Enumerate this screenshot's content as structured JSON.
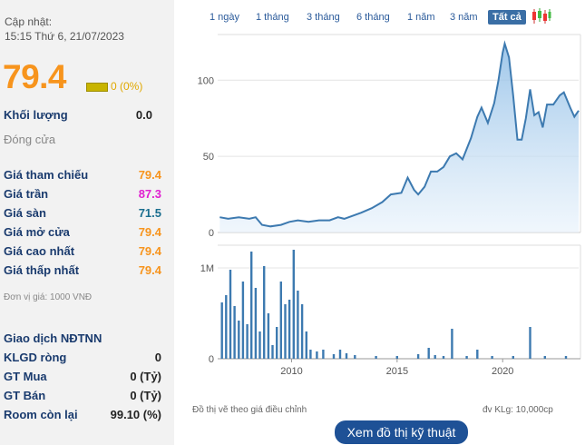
{
  "header": {
    "update_label": "Cập nhật:",
    "update_time": "15:15 Thứ 6, 21/07/2023",
    "price": "79.4",
    "change": "0 (0%)"
  },
  "volume": {
    "label": "Khối lượng",
    "value": "0.0"
  },
  "status": "Đóng cửa",
  "prices": [
    {
      "label": "Giá tham chiếu",
      "value": "79.4",
      "color": "#f7941d"
    },
    {
      "label": "Giá trần",
      "value": "87.3",
      "color": "#e020d0"
    },
    {
      "label": "Giá sàn",
      "value": "71.5",
      "color": "#1a6e8e"
    },
    {
      "label": "Giá mở cửa",
      "value": "79.4",
      "color": "#f7941d"
    },
    {
      "label": "Giá cao nhất",
      "value": "79.4",
      "color": "#f7941d"
    },
    {
      "label": "Giá thấp nhất",
      "value": "79.4",
      "color": "#f7941d"
    }
  ],
  "unit_note": "Đơn vị giá: 1000 VNĐ",
  "foreign": {
    "title": "Giao dịch NĐTNN",
    "rows": [
      {
        "label": "KLGD ròng",
        "value": "0"
      },
      {
        "label": "GT Mua",
        "value": "0 (Tỷ)"
      },
      {
        "label": "GT Bán",
        "value": "0 (Tỷ)"
      },
      {
        "label": "Room còn lại",
        "value": "99.10 (%)"
      }
    ]
  },
  "tabs": [
    "1 ngày",
    "1 tháng",
    "3 tháng",
    "6 tháng",
    "1 năm",
    "3 năm",
    "Tất cả"
  ],
  "active_tab": "Tất cả",
  "chart_footer_left": "Đồ thị vẽ theo giá điều chỉnh",
  "chart_footer_right": "đv KLg: 10,000cp",
  "technical_button": "Xem đồ thị kỹ thuật",
  "chart_data": {
    "type": "area",
    "xlabel": "",
    "ylabel": "",
    "x_ticks": [
      "2010",
      "2015",
      "2020"
    ],
    "price_ticks": [
      "0",
      "50",
      "100"
    ],
    "volume_ticks": [
      "0",
      "1M"
    ],
    "price_ylim": [
      0,
      130
    ],
    "volume_ylim": [
      0,
      1.25
    ],
    "xlim": [
      2006.5,
      2023.6
    ],
    "line_color": "#3d7ab0",
    "price_series": [
      [
        2006.6,
        10
      ],
      [
        2007.0,
        9
      ],
      [
        2007.5,
        10
      ],
      [
        2008.0,
        9
      ],
      [
        2008.3,
        10
      ],
      [
        2008.6,
        5
      ],
      [
        2009.0,
        4
      ],
      [
        2009.5,
        5
      ],
      [
        2009.9,
        7
      ],
      [
        2010.3,
        8
      ],
      [
        2010.8,
        7
      ],
      [
        2011.3,
        8
      ],
      [
        2011.8,
        8
      ],
      [
        2012.2,
        10
      ],
      [
        2012.5,
        9
      ],
      [
        2012.9,
        11
      ],
      [
        2013.3,
        13
      ],
      [
        2013.8,
        16
      ],
      [
        2014.3,
        20
      ],
      [
        2014.7,
        25
      ],
      [
        2015.2,
        26
      ],
      [
        2015.5,
        36
      ],
      [
        2015.8,
        28
      ],
      [
        2016.0,
        25
      ],
      [
        2016.3,
        30
      ],
      [
        2016.6,
        40
      ],
      [
        2016.9,
        40
      ],
      [
        2017.2,
        43
      ],
      [
        2017.5,
        50
      ],
      [
        2017.8,
        52
      ],
      [
        2018.1,
        48
      ],
      [
        2018.5,
        62
      ],
      [
        2018.8,
        76
      ],
      [
        2019.0,
        82
      ],
      [
        2019.3,
        72
      ],
      [
        2019.6,
        85
      ],
      [
        2019.8,
        100
      ],
      [
        2020.0,
        118
      ],
      [
        2020.1,
        124
      ],
      [
        2020.3,
        115
      ],
      [
        2020.5,
        90
      ],
      [
        2020.7,
        61
      ],
      [
        2020.9,
        61
      ],
      [
        2021.1,
        75
      ],
      [
        2021.3,
        94
      ],
      [
        2021.5,
        77
      ],
      [
        2021.7,
        79
      ],
      [
        2021.9,
        69
      ],
      [
        2022.1,
        84
      ],
      [
        2022.4,
        84
      ],
      [
        2022.7,
        90
      ],
      [
        2022.9,
        92
      ],
      [
        2023.2,
        82
      ],
      [
        2023.4,
        76
      ],
      [
        2023.6,
        80
      ]
    ],
    "volume_series": [
      [
        2006.7,
        0.62
      ],
      [
        2006.9,
        0.7
      ],
      [
        2007.1,
        0.98
      ],
      [
        2007.3,
        0.58
      ],
      [
        2007.5,
        0.42
      ],
      [
        2007.7,
        0.85
      ],
      [
        2007.9,
        0.38
      ],
      [
        2008.1,
        1.18
      ],
      [
        2008.3,
        0.78
      ],
      [
        2008.5,
        0.3
      ],
      [
        2008.7,
        1.02
      ],
      [
        2008.9,
        0.5
      ],
      [
        2009.1,
        0.15
      ],
      [
        2009.3,
        0.35
      ],
      [
        2009.5,
        0.85
      ],
      [
        2009.7,
        0.6
      ],
      [
        2009.9,
        0.65
      ],
      [
        2010.1,
        1.2
      ],
      [
        2010.3,
        0.75
      ],
      [
        2010.5,
        0.6
      ],
      [
        2010.7,
        0.3
      ],
      [
        2010.9,
        0.1
      ],
      [
        2011.2,
        0.08
      ],
      [
        2011.5,
        0.1
      ],
      [
        2012.0,
        0.05
      ],
      [
        2012.3,
        0.1
      ],
      [
        2012.6,
        0.06
      ],
      [
        2013.0,
        0.04
      ],
      [
        2014.0,
        0.03
      ],
      [
        2015.0,
        0.03
      ],
      [
        2016.0,
        0.05
      ],
      [
        2016.5,
        0.12
      ],
      [
        2016.8,
        0.04
      ],
      [
        2017.2,
        0.03
      ],
      [
        2017.6,
        0.33
      ],
      [
        2018.3,
        0.03
      ],
      [
        2018.8,
        0.1
      ],
      [
        2019.5,
        0.03
      ],
      [
        2020.5,
        0.03
      ],
      [
        2021.3,
        0.35
      ],
      [
        2022.0,
        0.03
      ],
      [
        2023.0,
        0.03
      ]
    ]
  }
}
